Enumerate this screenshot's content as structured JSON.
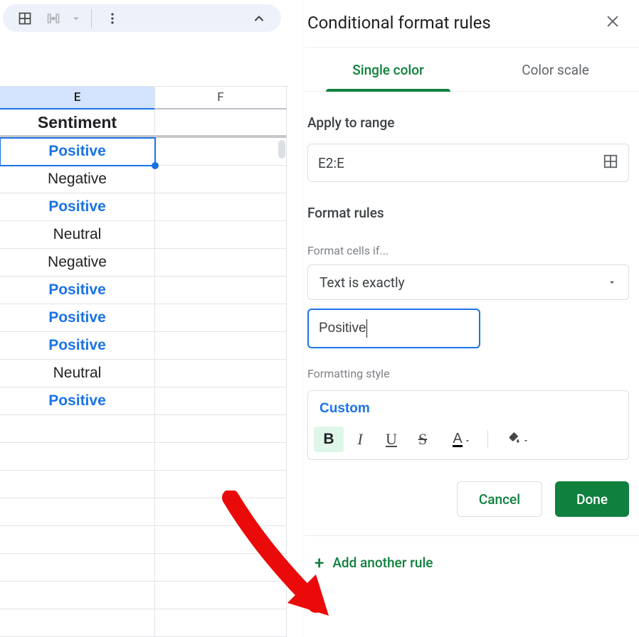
{
  "toolbar": {
    "collapse_icon": "chevron-up"
  },
  "columns": [
    "E",
    "F"
  ],
  "header_row": {
    "sentiment_label": "Sentiment"
  },
  "rows": [
    {
      "value": "Positive",
      "style": "pos",
      "selected": true
    },
    {
      "value": "Negative",
      "style": ""
    },
    {
      "value": "Positive",
      "style": "pos"
    },
    {
      "value": "Neutral",
      "style": ""
    },
    {
      "value": "Negative",
      "style": ""
    },
    {
      "value": "Positive",
      "style": "pos"
    },
    {
      "value": "Positive",
      "style": "pos"
    },
    {
      "value": "Positive",
      "style": "pos"
    },
    {
      "value": "Neutral",
      "style": ""
    },
    {
      "value": "Positive",
      "style": "pos"
    }
  ],
  "panel": {
    "title": "Conditional format rules",
    "tabs": {
      "single_color": "Single color",
      "color_scale": "Color scale"
    },
    "apply_to_range_label": "Apply to range",
    "range_value": "E2:E",
    "format_rules_label": "Format rules",
    "format_cells_if_label": "Format cells if...",
    "condition_value": "Text is exactly",
    "match_value": "Positive",
    "formatting_style_label": "Formatting style",
    "style_name": "Custom",
    "buttons": {
      "cancel": "Cancel",
      "done": "Done"
    },
    "add_rule": "Add another rule"
  }
}
